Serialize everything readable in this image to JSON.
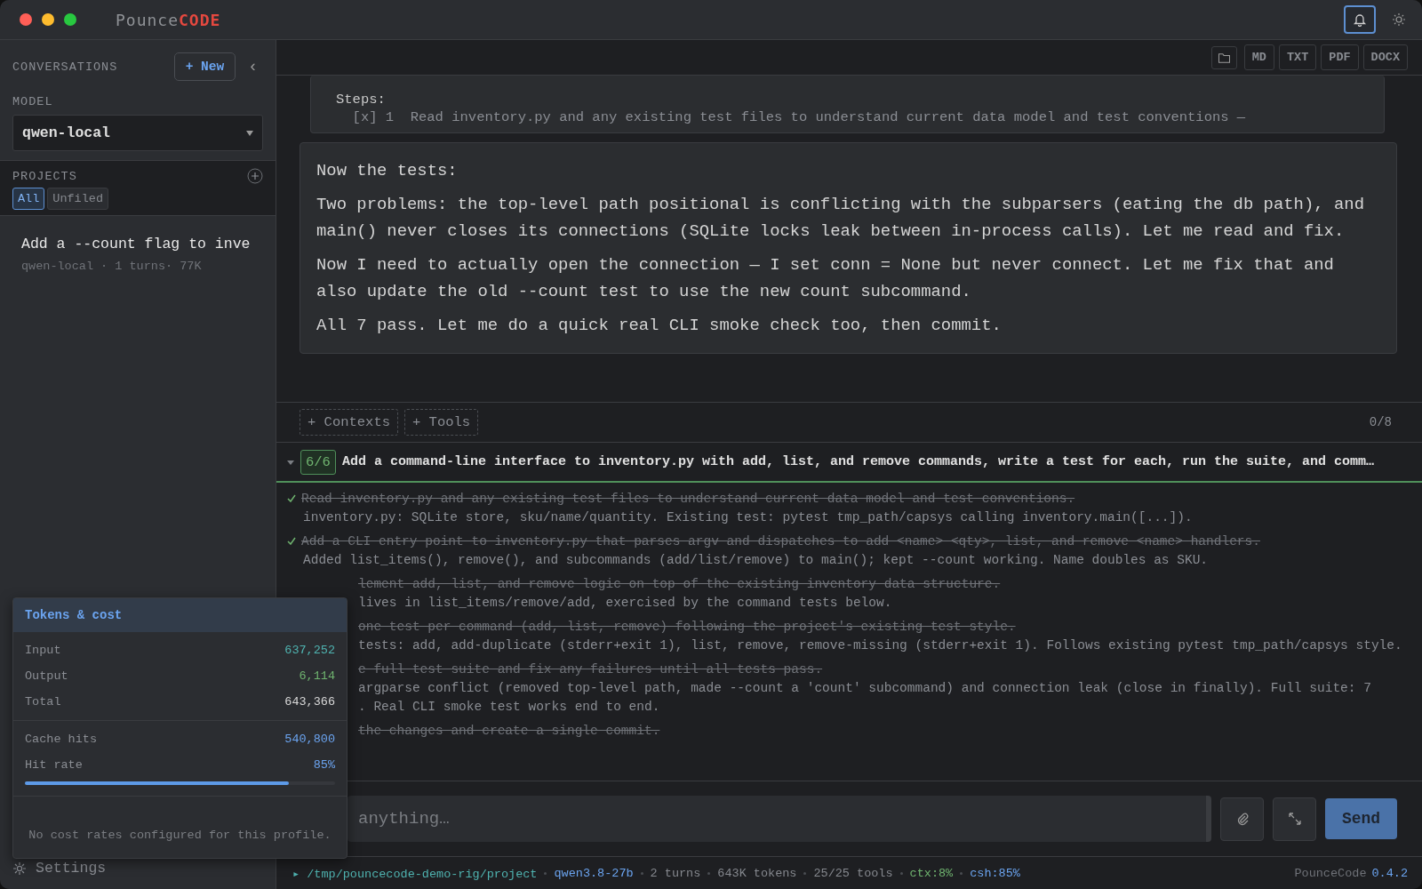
{
  "window": {
    "title_first": "Pounce",
    "title_second": "CODE",
    "notifications_on": true
  },
  "sidebar": {
    "conversations_label": "CONVERSATIONS",
    "new_button": "+ New",
    "collapse": "‹",
    "model_label": "MODEL",
    "model": "qwen-local",
    "projects_label": "PROJECTS",
    "filters": [
      {
        "label": "All",
        "selected": true
      },
      {
        "label": "Unfiled",
        "selected": false
      }
    ],
    "conversations": [
      {
        "title": "Add a --count flag to inve",
        "meta": "qwen-local · 1 turns· 77K"
      }
    ],
    "settings": "Settings"
  },
  "export_buttons": [
    "MD",
    "TXT",
    "PDF",
    "DOCX"
  ],
  "messages": [
    {
      "kind": "tool",
      "lines": [
        "Steps:",
        "  [x] 1  Read inventory.py and any existing test files to understand current data model and test conventions —"
      ]
    },
    {
      "kind": "assistant",
      "lines": [
        "Now the tests:",
        "Two problems: the top-level path positional is conflicting with the subparsers (eating the db path), and main() never closes its connections (SQLite locks leak between in-process calls). Let me read and fix.",
        "Now I need to actually open the connection — I set conn = None but never connect. Let me fix that and also update the old --count test to use the new count subcommand.",
        "All 7 pass. Let me do a quick real CLI smoke check too, then commit."
      ]
    }
  ],
  "context_bar": {
    "buttons": [
      "+ Contexts",
      "+ Tools"
    ],
    "count": "0/8"
  },
  "plan": {
    "expanded": true,
    "progress": "6/6",
    "title": "Add a command-line interface to inventory.py with add, list, and remove commands, write a test for each, run the suite, and comm…",
    "tasks": [
      {
        "kind": "full",
        "done": true,
        "title": "Read inventory.py and any existing test files to understand current data model and test conventions.",
        "note": "inventory.py: SQLite store, sku/name/quantity. Existing test: pytest tmp_path/capsys calling inventory.main([...])."
      },
      {
        "kind": "full",
        "done": true,
        "title": "Add a CLI entry point to inventory.py that parses argv and dispatches to add <name> <qty>, list, and remove <name> handlers.",
        "note": "Added list_items(), remove(), and subcommands (add/list/remove) to main(); kept --count working. Name doubles as SKU."
      },
      {
        "kind": "covered",
        "done": true,
        "title": "lement add, list, and remove logic on top of the existing inventory data structure.",
        "note": "lives in list_items/remove/add, exercised by the command tests below."
      },
      {
        "kind": "covered",
        "done": true,
        "title": "one test per command (add, list, remove) following the project's existing test style.",
        "note": "tests: add, add-duplicate (stderr+exit 1), list, remove, remove-missing (stderr+exit 1). Follows existing pytest tmp_path/capsys style."
      },
      {
        "kind": "covered",
        "done": true,
        "title": "e full test suite and fix any failures until all tests pass.",
        "note": "argparse conflict (removed top-level path, made --count a 'count' subcommand) and connection leak (close in finally). Full suite: 7",
        "note2": ". Real CLI smoke test works end to end."
      },
      {
        "kind": "covered",
        "done": true,
        "title": "the changes and create a single commit."
      }
    ]
  },
  "composer": {
    "placeholder": "anything…",
    "send": "Send"
  },
  "status_bar": {
    "items": [
      {
        "text": "▸ /tmp/pouncecode-demo-rig/project",
        "color": "#4fb3b0"
      },
      {
        "text": "qwen3.8-27b",
        "color": "#6ba4f0"
      },
      {
        "text": "2 turns",
        "color": "#85888e"
      },
      {
        "text": "643K tokens",
        "color": "#85888e"
      },
      {
        "text": "25/25 tools",
        "color": "#85888e"
      },
      {
        "text": "ctx:8%",
        "color": "#6fb36f"
      },
      {
        "text": "csh:85%",
        "color": "#6ba4f0"
      }
    ],
    "app": "PounceCode",
    "version": "0.4.2"
  },
  "tokens_popover": {
    "title": "Tokens & cost",
    "rows": [
      {
        "label": "Input",
        "value": "637,252",
        "color": "#4fb3b0"
      },
      {
        "label": "Output",
        "value": "6,114",
        "color": "#6fb36f"
      },
      {
        "label": "Total",
        "value": "643,366",
        "color": "#d8d8d8"
      }
    ],
    "cache_rows": [
      {
        "label": "Cache hits",
        "value": "540,800",
        "color": "#6ba4f0"
      },
      {
        "label": "Hit rate",
        "value": "85%",
        "color": "#6ba4f0"
      }
    ],
    "hit_rate": {
      "level": 0.85
    },
    "note": "No cost rates configured for this profile."
  }
}
